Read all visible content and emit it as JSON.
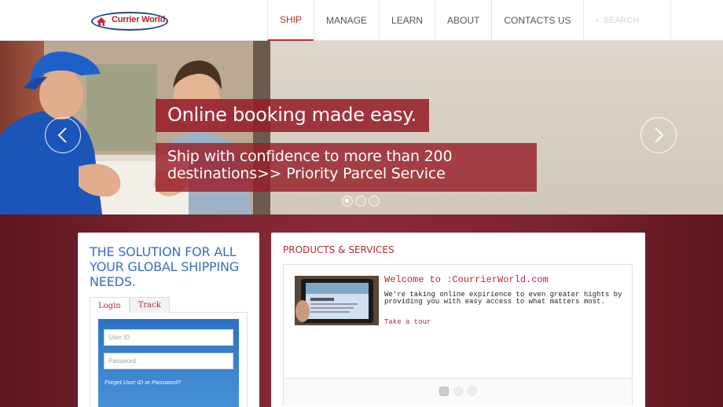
{
  "header": {
    "logo_text": "Currier World",
    "nav": [
      {
        "label": "SHIP",
        "active": true
      },
      {
        "label": "MANAGE",
        "active": false
      },
      {
        "label": "LEARN",
        "active": false
      },
      {
        "label": "ABOUT",
        "active": false
      },
      {
        "label": "CONTACTS US",
        "active": false
      }
    ],
    "search_placeholder": "SEARCH"
  },
  "hero": {
    "caption_title": "Online booking made easy.",
    "caption_line1": "Ship with confidence to more than 200",
    "caption_line2": "destinations>> Priority Parcel Service",
    "slide_count": 3,
    "active_slide": 1
  },
  "left_panel": {
    "tagline": "THE SOLUTION FOR ALL YOUR GLOBAL SHIPPING NEEDS.",
    "tabs": [
      "Login",
      "Track"
    ],
    "user_id_placeholder": "User ID",
    "password_placeholder": "Password",
    "forgot_link": "Forget User ID or Password?"
  },
  "right_panel": {
    "title": "PRODUCTS & SERVICES",
    "welcome": "Welcome to :CourrierWorld.com",
    "description": "We're taking online expirience to even greater hights by providing you with easy access to what matters most.",
    "tour_link": "Take a tour",
    "slide_count": 3,
    "active_slide": 1
  },
  "colors": {
    "brand_red": "#b22a35",
    "nav_active": "#c62a35",
    "tagline_blue": "#3b6ec4",
    "band_dark": "#6a1c24"
  }
}
